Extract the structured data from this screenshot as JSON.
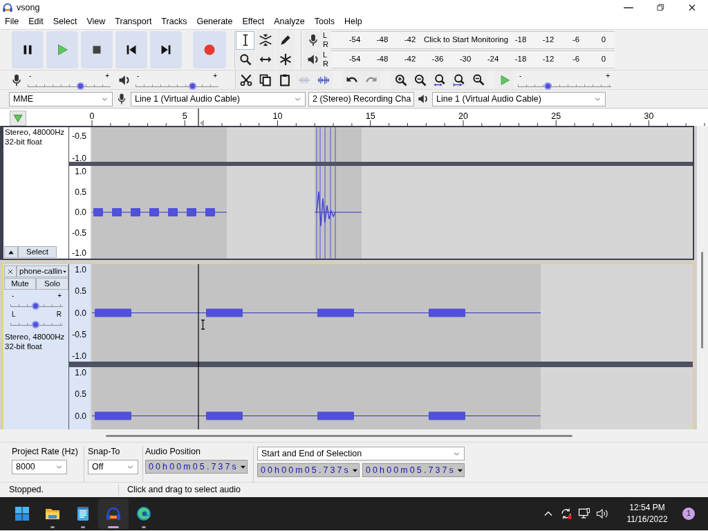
{
  "window": {
    "title": "vsong"
  },
  "menu": [
    "File",
    "Edit",
    "Select",
    "View",
    "Transport",
    "Tracks",
    "Generate",
    "Effect",
    "Analyze",
    "Tools",
    "Help"
  ],
  "transport": [
    {
      "kind": "pause"
    },
    {
      "kind": "play"
    },
    {
      "kind": "stop"
    },
    {
      "kind": "skip-start"
    },
    {
      "kind": "skip-end"
    },
    {
      "kind": "record"
    }
  ],
  "tools": [
    {
      "kind": "select",
      "selected": true
    },
    {
      "kind": "envelope",
      "selected": false
    },
    {
      "kind": "draw",
      "selected": false
    },
    {
      "kind": "zoom",
      "selected": false
    },
    {
      "kind": "time-shift",
      "selected": false
    },
    {
      "kind": "multi",
      "selected": false
    }
  ],
  "meters": {
    "record": {
      "channels": [
        "L",
        "R"
      ],
      "ticks_before": [
        "-54",
        "-48",
        "-42"
      ],
      "prompt": "Click to Start Monitoring",
      "ticks_after": [
        "-18",
        "-12",
        "-6",
        "0"
      ]
    },
    "playback": {
      "channels": [
        "L",
        "R"
      ],
      "ticks": [
        "-54",
        "-48",
        "-42",
        "-36",
        "-30",
        "-24",
        "-18",
        "-12",
        "-6",
        "0"
      ]
    }
  },
  "mixer": {
    "recording": {
      "min": "-",
      "max": "+",
      "level": 0.65
    },
    "playback": {
      "min": "-",
      "max": "+",
      "level": 0.7
    }
  },
  "edit": [
    {
      "kind": "cut",
      "disabled": false
    },
    {
      "kind": "copy",
      "disabled": false
    },
    {
      "kind": "paste",
      "disabled": false
    },
    {
      "kind": "trim",
      "disabled": true
    },
    {
      "kind": "silence",
      "disabled": false
    }
  ],
  "history": [
    {
      "kind": "undo",
      "disabled": false
    },
    {
      "kind": "redo",
      "disabled": true
    }
  ],
  "zoom": [
    {
      "kind": "zoom-in"
    },
    {
      "kind": "zoom-out"
    },
    {
      "kind": "fit-selection"
    },
    {
      "kind": "fit-project"
    },
    {
      "kind": "zoom-toggle"
    }
  ],
  "play_at_speed": {
    "min": "-",
    "max": "+",
    "level": 0.33
  },
  "devices": {
    "host": "MME",
    "recording": "Line 1 (Virtual Audio Cable)",
    "channels": "2 (Stereo) Recording Cha",
    "playback": "Line 1 (Virtual Audio Cable)"
  },
  "timeline": {
    "ticks": [
      "0",
      "5",
      "10",
      "15",
      "20",
      "25",
      "30"
    ]
  },
  "tracks": [
    {
      "selected": false,
      "format": [
        "Stereo, 48000Hz",
        "32-bit float"
      ],
      "select_button": "Select",
      "channels": [
        {
          "scale": [
            "-0.5",
            "-1.0"
          ]
        },
        {
          "scale": [
            "1.0",
            "0.5",
            "0.0",
            "-0.5",
            "-1.0"
          ]
        }
      ]
    },
    {
      "selected": true,
      "name": "phone-callin",
      "mute": "Mute",
      "solo": "Solo",
      "gain": {
        "min": "-",
        "max": "+",
        "level": 0.5
      },
      "pan": {
        "left": "L",
        "right": "R",
        "level": 0.5
      },
      "format": [
        "Stereo, 48000Hz",
        "32-bit float"
      ],
      "channels": [
        {
          "scale": [
            "1.0",
            "0.5",
            "0.0",
            "-0.5",
            "-1.0"
          ]
        },
        {
          "scale": [
            "1.0",
            "0.5",
            "0.0"
          ]
        }
      ]
    }
  ],
  "selection_bar": {
    "rate_label": "Project Rate (Hz)",
    "rate": "8000",
    "snap_label": "Snap-To",
    "snap": "Off",
    "position_label": "Audio Position",
    "position": "00h00m05.737s",
    "mode": "Start and End of Selection",
    "start": "00h00m05.737s",
    "end": "00h00m05.737s"
  },
  "status": [
    "Stopped.",
    "Click and drag to select audio"
  ],
  "taskbar": {
    "apps": [
      {
        "kind": "start",
        "running": false,
        "selected": false
      },
      {
        "kind": "explorer",
        "running": true,
        "selected": false
      },
      {
        "kind": "notepad",
        "running": true,
        "selected": false
      },
      {
        "kind": "audacity",
        "running": true,
        "selected": true
      },
      {
        "kind": "edge",
        "running": true,
        "selected": false
      }
    ],
    "time": "12:54 PM",
    "date": "11/16/2022",
    "notifications": "1"
  }
}
